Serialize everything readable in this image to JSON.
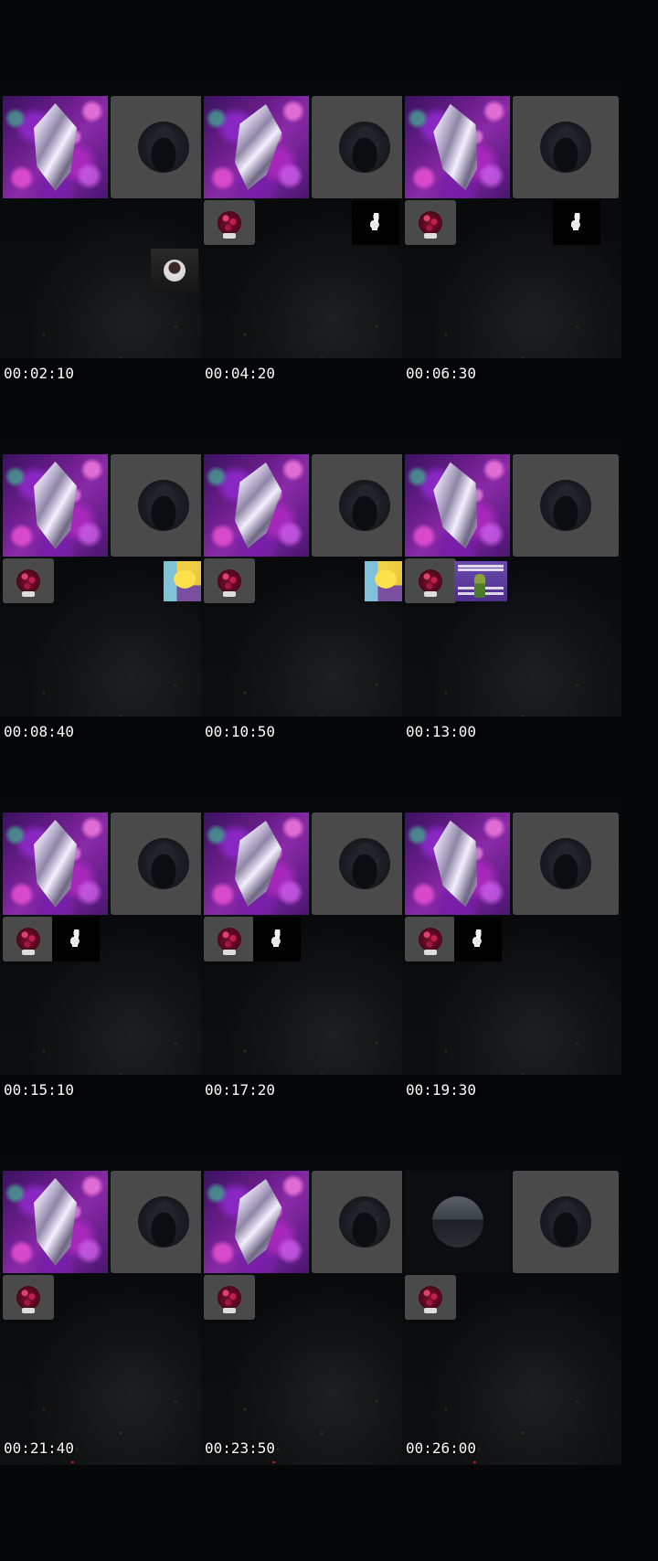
{
  "title": "",
  "frames": [
    {
      "timestamp": "00:02:10",
      "main_left": "crystal",
      "extras": [
        "floating-avatar"
      ]
    },
    {
      "timestamp": "00:04:20",
      "main_left": "crystal",
      "extras": [
        "berry",
        "bunny-right"
      ]
    },
    {
      "timestamp": "00:06:30",
      "main_left": "crystal",
      "extras": [
        "berry",
        "bunny-right"
      ]
    },
    {
      "timestamp": "00:08:40",
      "main_left": "crystal",
      "extras": [
        "berry",
        "simpsons-right"
      ]
    },
    {
      "timestamp": "00:10:50",
      "main_left": "crystal",
      "extras": [
        "berry",
        "simpsons-right"
      ]
    },
    {
      "timestamp": "00:13:00",
      "main_left": "crystal",
      "extras": [
        "berry",
        "meme-second"
      ]
    },
    {
      "timestamp": "00:15:10",
      "main_left": "crystal",
      "extras": [
        "berry",
        "bunny-second"
      ]
    },
    {
      "timestamp": "00:17:20",
      "main_left": "crystal",
      "extras": [
        "berry",
        "bunny-second"
      ]
    },
    {
      "timestamp": "00:19:30",
      "main_left": "crystal",
      "extras": [
        "berry",
        "bunny-second"
      ]
    },
    {
      "timestamp": "00:21:40",
      "main_left": "crystal",
      "extras": [
        "berry"
      ]
    },
    {
      "timestamp": "00:23:50",
      "main_left": "crystal",
      "extras": [
        "berry"
      ]
    },
    {
      "timestamp": "00:26:00",
      "main_left": "street-avatar",
      "extras": [
        "berry"
      ]
    }
  ],
  "icons": {
    "crystal": "crystal-icon",
    "user_avatar": "hooded-figure-avatar",
    "berry": "berry-icon",
    "bunny": "bunny-icon",
    "simpsons": "cartoon-thumbnail",
    "meme": "meme-thumbnail"
  },
  "colors": {
    "background": "#050607",
    "tile_gray": "#4a4a4a",
    "timestamp_text": "#ffffff",
    "accent_purple": "#8a2aa8"
  }
}
